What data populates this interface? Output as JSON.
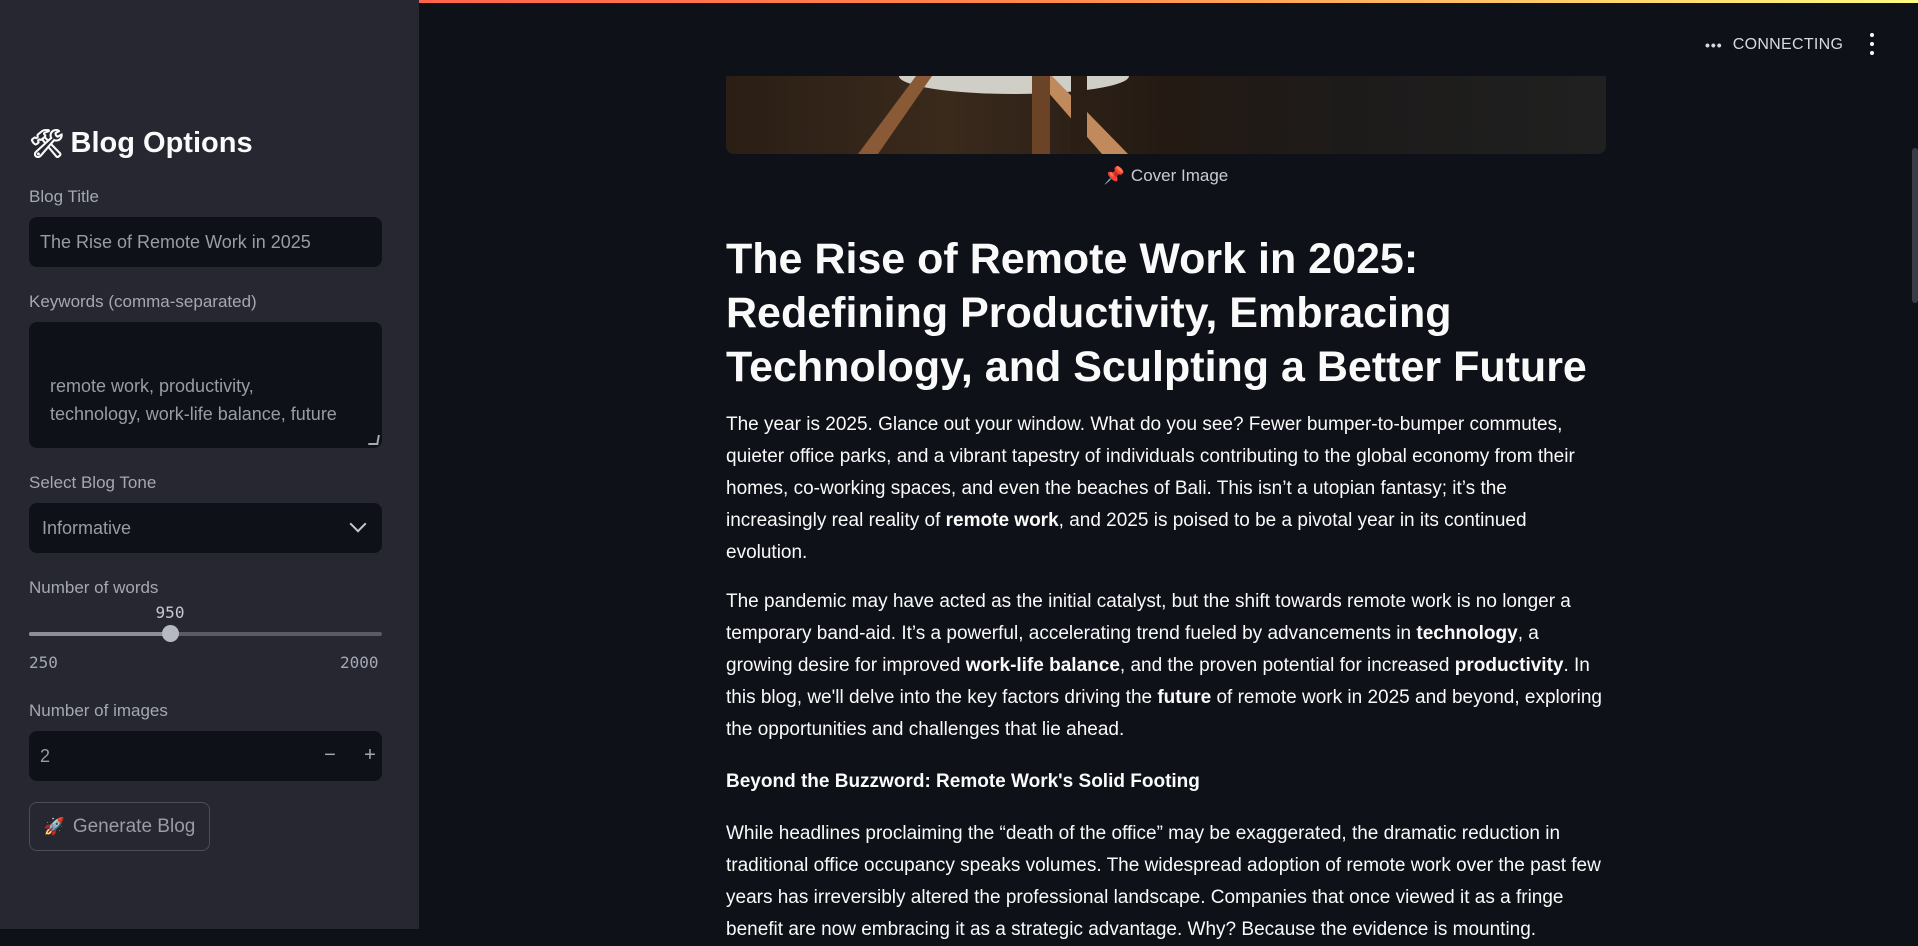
{
  "sidebar": {
    "title": "Blog Options",
    "title_icon": "hammer-wrench-icon",
    "blog_title_label": "Blog Title",
    "blog_title_value": "The Rise of Remote Work in 2025",
    "keywords_label": "Keywords (comma-separated)",
    "keywords_value": "remote work, productivity,\ntechnology, work-life balance, future",
    "tone_label": "Select Blog Tone",
    "tone_value": "Informative",
    "words_label": "Number of words",
    "words_value": "950",
    "words_fraction": 0.4,
    "words_min": "250",
    "words_max": "2000",
    "images_label": "Number of images",
    "images_value": "2",
    "minus": "−",
    "plus": "+",
    "generate_label": "Generate Blog",
    "generate_icon": "rocket-icon"
  },
  "header": {
    "status": "CONNECTING",
    "status_icon": "dots-icon",
    "menu_icon": "kebab-menu-icon"
  },
  "main": {
    "cover_caption": "Cover Image",
    "cover_caption_icon": "pushpin-icon",
    "heading": "The Rise of Remote Work in 2025: Redefining Productivity, Embracing Technology, and Sculpting a Better Future",
    "p1": {
      "a": "The year is 2025. Glance out your window. What do you see? Fewer bumper-to-bumper commutes, quieter office parks, and a vibrant tapestry of individuals contributing to the global economy from their homes, co-working spaces, and even the beaches of Bali. This isn’t a utopian fantasy; it’s the increasingly real reality of ",
      "b1": "remote work",
      "c": ", and 2025 is poised to be a pivotal year in its continued evolution."
    },
    "p2": {
      "a": "The pandemic may have acted as the initial catalyst, but the shift towards remote work is no longer a temporary band-aid. It’s a powerful, accelerating trend fueled by advancements in ",
      "b1": "technology",
      "c": ", a growing desire for improved ",
      "b2": "work-life balance",
      "d": ", and the proven potential for increased ",
      "b3": "productivity",
      "e": ". In this blog, we'll delve into the key factors driving the ",
      "b4": "future",
      "f": " of remote work in 2025 and beyond, exploring the opportunities and challenges that lie ahead."
    },
    "subheading": "Beyond the Buzzword: Remote Work's Solid Footing",
    "p4": "While headlines proclaiming the “death of the office” may be exaggerated, the dramatic reduction in traditional office occupancy speaks volumes. The widespread adoption of remote work over the past few years has irreversibly altered the professional landscape. Companies that once viewed it as a fringe benefit are now embracing it as a strategic advantage. Why? Because the evidence is mounting."
  }
}
